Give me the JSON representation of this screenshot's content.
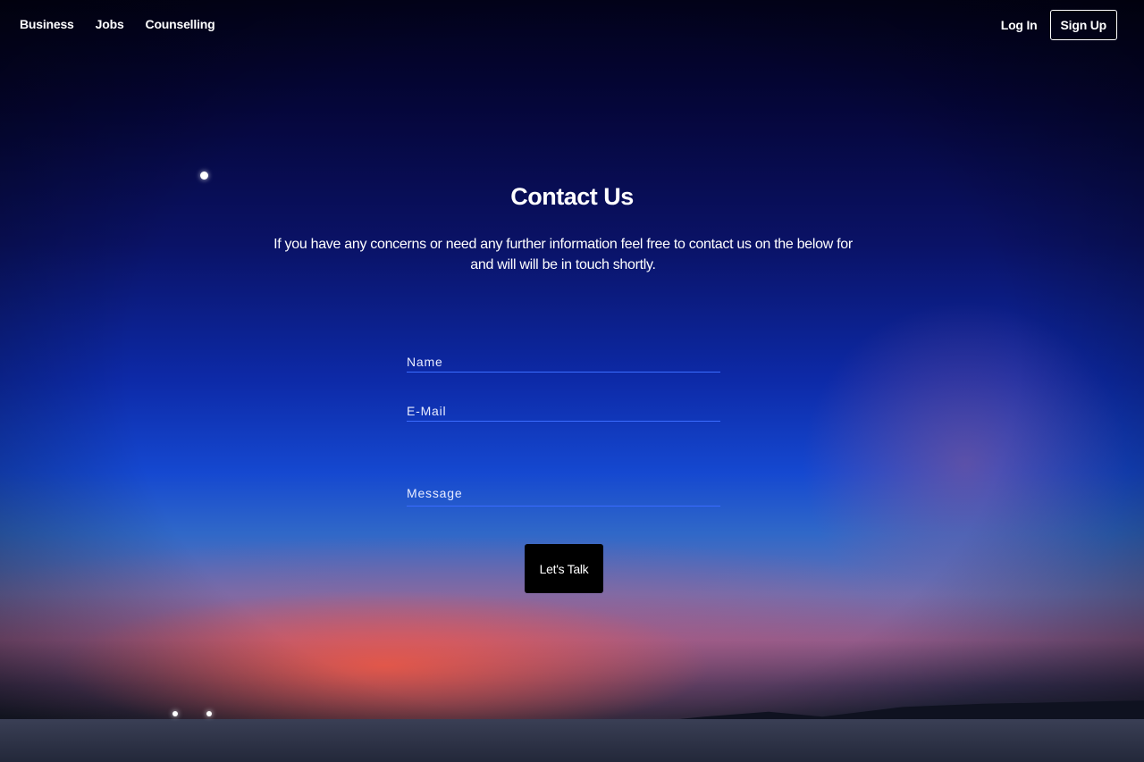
{
  "nav": {
    "left_links": [
      "Business",
      "Jobs",
      "Counselling"
    ],
    "login_label": "Log In",
    "signup_label": "Sign Up"
  },
  "contact": {
    "title": "Contact Us",
    "description": "If you have any concerns or need any further information feel free to contact us on the below for and will will be in touch shortly.",
    "name_placeholder": "Name",
    "email_placeholder": "E-Mail",
    "message_placeholder": "Message",
    "submit_label": "Let's Talk"
  }
}
